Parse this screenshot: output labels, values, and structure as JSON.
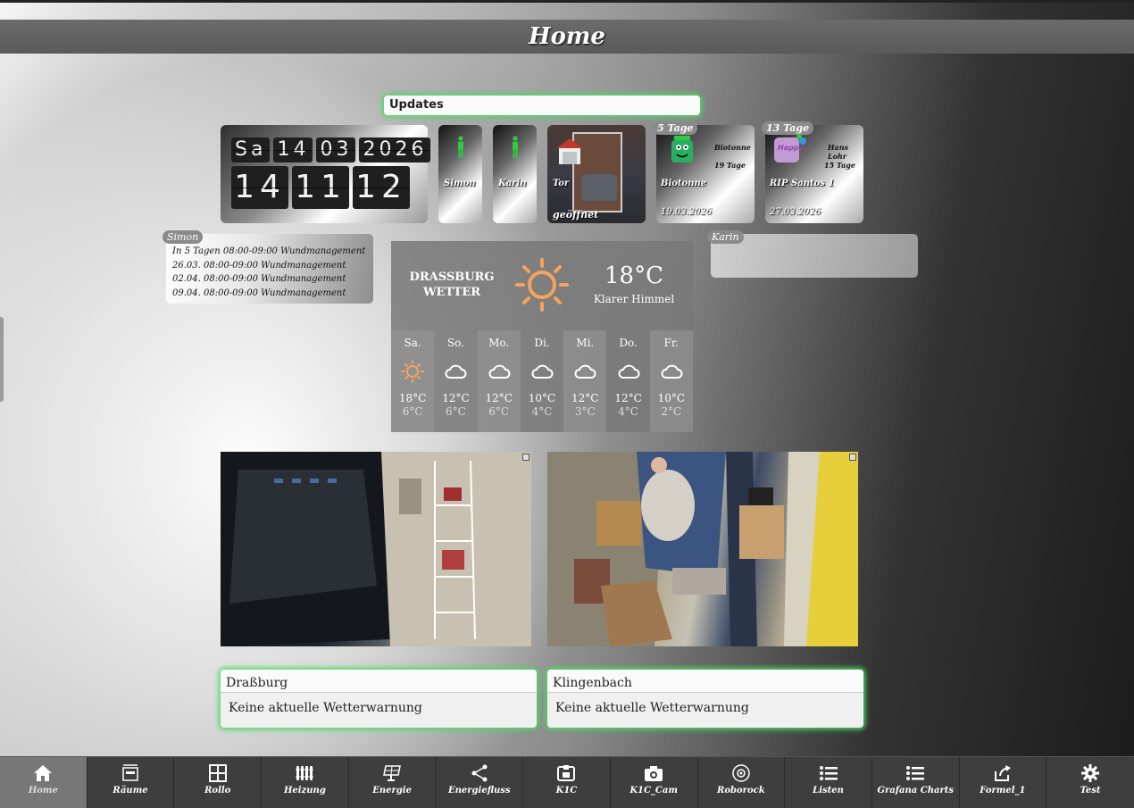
{
  "header": {
    "title": "Home"
  },
  "updates": {
    "label": "Updates"
  },
  "clock": {
    "weekday": "Sa",
    "day": "14",
    "month": "03",
    "year": "2026",
    "hour": "14",
    "minute": "11",
    "second": "12"
  },
  "presence": [
    {
      "name": "Simon",
      "color": "#2ecc40"
    },
    {
      "name": "Karin",
      "color": "#2ecc40"
    }
  ],
  "garage": {
    "label": "Tor",
    "status": "geöffnet"
  },
  "trash": [
    {
      "badge": "5 Tage",
      "type": "Biotonne",
      "next": "Biotonne",
      "next_days": "19 Tage",
      "date": "19.03.2026"
    },
    {
      "badge": "13 Tage",
      "type": "RIP Santos 1",
      "next": "Hans Lohr",
      "next_days": "15 Tage",
      "date": "27.03.2026"
    }
  ],
  "calendar_simon": {
    "badge": "Simon",
    "entries": [
      "In 5 Tagen 08:00-09:00 Wundmanagement",
      "26.03. 08:00-09:00 Wundmanagement",
      "02.04. 08:00-09:00 Wundmanagement",
      "09.04. 08:00-09:00 Wundmanagement"
    ]
  },
  "calendar_karin": {
    "badge": "Karin"
  },
  "weather": {
    "location_line1": "DRASSBURG",
    "location_line2": "WETTER",
    "temp": "18°C",
    "condition": "Klarer Himmel",
    "forecast": [
      {
        "day": "Sa.",
        "icon": "sun",
        "hi": "18°C",
        "lo": "6°C"
      },
      {
        "day": "So.",
        "icon": "cloud",
        "hi": "12°C",
        "lo": "6°C"
      },
      {
        "day": "Mo.",
        "icon": "cloud",
        "hi": "12°C",
        "lo": "6°C"
      },
      {
        "day": "Di.",
        "icon": "cloud",
        "hi": "10°C",
        "lo": "4°C"
      },
      {
        "day": "Mi.",
        "icon": "cloud",
        "hi": "12°C",
        "lo": "3°C"
      },
      {
        "day": "Do.",
        "icon": "cloud",
        "hi": "12°C",
        "lo": "4°C"
      },
      {
        "day": "Fr.",
        "icon": "cloud",
        "hi": "10°C",
        "lo": "2°C"
      }
    ]
  },
  "warnings": [
    {
      "title": "Draßburg",
      "text": "Keine aktuelle Wetterwarnung"
    },
    {
      "title": "Klingenbach",
      "text": "Keine aktuelle Wetterwarnung"
    }
  ],
  "nav": [
    {
      "label": "Home",
      "icon": "home-icon",
      "active": true
    },
    {
      "label": "Räume",
      "icon": "rooms-icon"
    },
    {
      "label": "Rollo",
      "icon": "window-icon"
    },
    {
      "label": "Heizung",
      "icon": "radiator-icon"
    },
    {
      "label": "Energie",
      "icon": "solar-panel-icon"
    },
    {
      "label": "Energiefluss",
      "icon": "share-icon"
    },
    {
      "label": "K1C",
      "icon": "printer-icon"
    },
    {
      "label": "K1C_Cam",
      "icon": "camera-icon"
    },
    {
      "label": "Roborock",
      "icon": "robot-vacuum-icon"
    },
    {
      "label": "Listen",
      "icon": "list-icon"
    },
    {
      "label": "Grafana Charts",
      "icon": "list-icon"
    },
    {
      "label": "Formel_1",
      "icon": "share-out-icon"
    },
    {
      "label": "Test",
      "icon": "gear-icon"
    }
  ]
}
